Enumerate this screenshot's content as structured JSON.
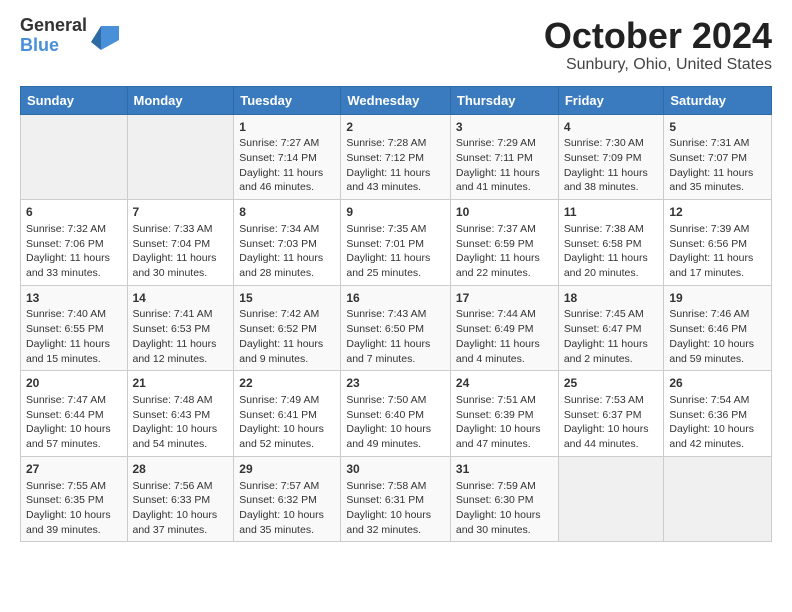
{
  "header": {
    "logo_general": "General",
    "logo_blue": "Blue",
    "title": "October 2024",
    "location": "Sunbury, Ohio, United States"
  },
  "days_of_week": [
    "Sunday",
    "Monday",
    "Tuesday",
    "Wednesday",
    "Thursday",
    "Friday",
    "Saturday"
  ],
  "weeks": [
    [
      {
        "day": "",
        "info": ""
      },
      {
        "day": "",
        "info": ""
      },
      {
        "day": "1",
        "info": "Sunrise: 7:27 AM\nSunset: 7:14 PM\nDaylight: 11 hours and 46 minutes."
      },
      {
        "day": "2",
        "info": "Sunrise: 7:28 AM\nSunset: 7:12 PM\nDaylight: 11 hours and 43 minutes."
      },
      {
        "day": "3",
        "info": "Sunrise: 7:29 AM\nSunset: 7:11 PM\nDaylight: 11 hours and 41 minutes."
      },
      {
        "day": "4",
        "info": "Sunrise: 7:30 AM\nSunset: 7:09 PM\nDaylight: 11 hours and 38 minutes."
      },
      {
        "day": "5",
        "info": "Sunrise: 7:31 AM\nSunset: 7:07 PM\nDaylight: 11 hours and 35 minutes."
      }
    ],
    [
      {
        "day": "6",
        "info": "Sunrise: 7:32 AM\nSunset: 7:06 PM\nDaylight: 11 hours and 33 minutes."
      },
      {
        "day": "7",
        "info": "Sunrise: 7:33 AM\nSunset: 7:04 PM\nDaylight: 11 hours and 30 minutes."
      },
      {
        "day": "8",
        "info": "Sunrise: 7:34 AM\nSunset: 7:03 PM\nDaylight: 11 hours and 28 minutes."
      },
      {
        "day": "9",
        "info": "Sunrise: 7:35 AM\nSunset: 7:01 PM\nDaylight: 11 hours and 25 minutes."
      },
      {
        "day": "10",
        "info": "Sunrise: 7:37 AM\nSunset: 6:59 PM\nDaylight: 11 hours and 22 minutes."
      },
      {
        "day": "11",
        "info": "Sunrise: 7:38 AM\nSunset: 6:58 PM\nDaylight: 11 hours and 20 minutes."
      },
      {
        "day": "12",
        "info": "Sunrise: 7:39 AM\nSunset: 6:56 PM\nDaylight: 11 hours and 17 minutes."
      }
    ],
    [
      {
        "day": "13",
        "info": "Sunrise: 7:40 AM\nSunset: 6:55 PM\nDaylight: 11 hours and 15 minutes."
      },
      {
        "day": "14",
        "info": "Sunrise: 7:41 AM\nSunset: 6:53 PM\nDaylight: 11 hours and 12 minutes."
      },
      {
        "day": "15",
        "info": "Sunrise: 7:42 AM\nSunset: 6:52 PM\nDaylight: 11 hours and 9 minutes."
      },
      {
        "day": "16",
        "info": "Sunrise: 7:43 AM\nSunset: 6:50 PM\nDaylight: 11 hours and 7 minutes."
      },
      {
        "day": "17",
        "info": "Sunrise: 7:44 AM\nSunset: 6:49 PM\nDaylight: 11 hours and 4 minutes."
      },
      {
        "day": "18",
        "info": "Sunrise: 7:45 AM\nSunset: 6:47 PM\nDaylight: 11 hours and 2 minutes."
      },
      {
        "day": "19",
        "info": "Sunrise: 7:46 AM\nSunset: 6:46 PM\nDaylight: 10 hours and 59 minutes."
      }
    ],
    [
      {
        "day": "20",
        "info": "Sunrise: 7:47 AM\nSunset: 6:44 PM\nDaylight: 10 hours and 57 minutes."
      },
      {
        "day": "21",
        "info": "Sunrise: 7:48 AM\nSunset: 6:43 PM\nDaylight: 10 hours and 54 minutes."
      },
      {
        "day": "22",
        "info": "Sunrise: 7:49 AM\nSunset: 6:41 PM\nDaylight: 10 hours and 52 minutes."
      },
      {
        "day": "23",
        "info": "Sunrise: 7:50 AM\nSunset: 6:40 PM\nDaylight: 10 hours and 49 minutes."
      },
      {
        "day": "24",
        "info": "Sunrise: 7:51 AM\nSunset: 6:39 PM\nDaylight: 10 hours and 47 minutes."
      },
      {
        "day": "25",
        "info": "Sunrise: 7:53 AM\nSunset: 6:37 PM\nDaylight: 10 hours and 44 minutes."
      },
      {
        "day": "26",
        "info": "Sunrise: 7:54 AM\nSunset: 6:36 PM\nDaylight: 10 hours and 42 minutes."
      }
    ],
    [
      {
        "day": "27",
        "info": "Sunrise: 7:55 AM\nSunset: 6:35 PM\nDaylight: 10 hours and 39 minutes."
      },
      {
        "day": "28",
        "info": "Sunrise: 7:56 AM\nSunset: 6:33 PM\nDaylight: 10 hours and 37 minutes."
      },
      {
        "day": "29",
        "info": "Sunrise: 7:57 AM\nSunset: 6:32 PM\nDaylight: 10 hours and 35 minutes."
      },
      {
        "day": "30",
        "info": "Sunrise: 7:58 AM\nSunset: 6:31 PM\nDaylight: 10 hours and 32 minutes."
      },
      {
        "day": "31",
        "info": "Sunrise: 7:59 AM\nSunset: 6:30 PM\nDaylight: 10 hours and 30 minutes."
      },
      {
        "day": "",
        "info": ""
      },
      {
        "day": "",
        "info": ""
      }
    ]
  ]
}
